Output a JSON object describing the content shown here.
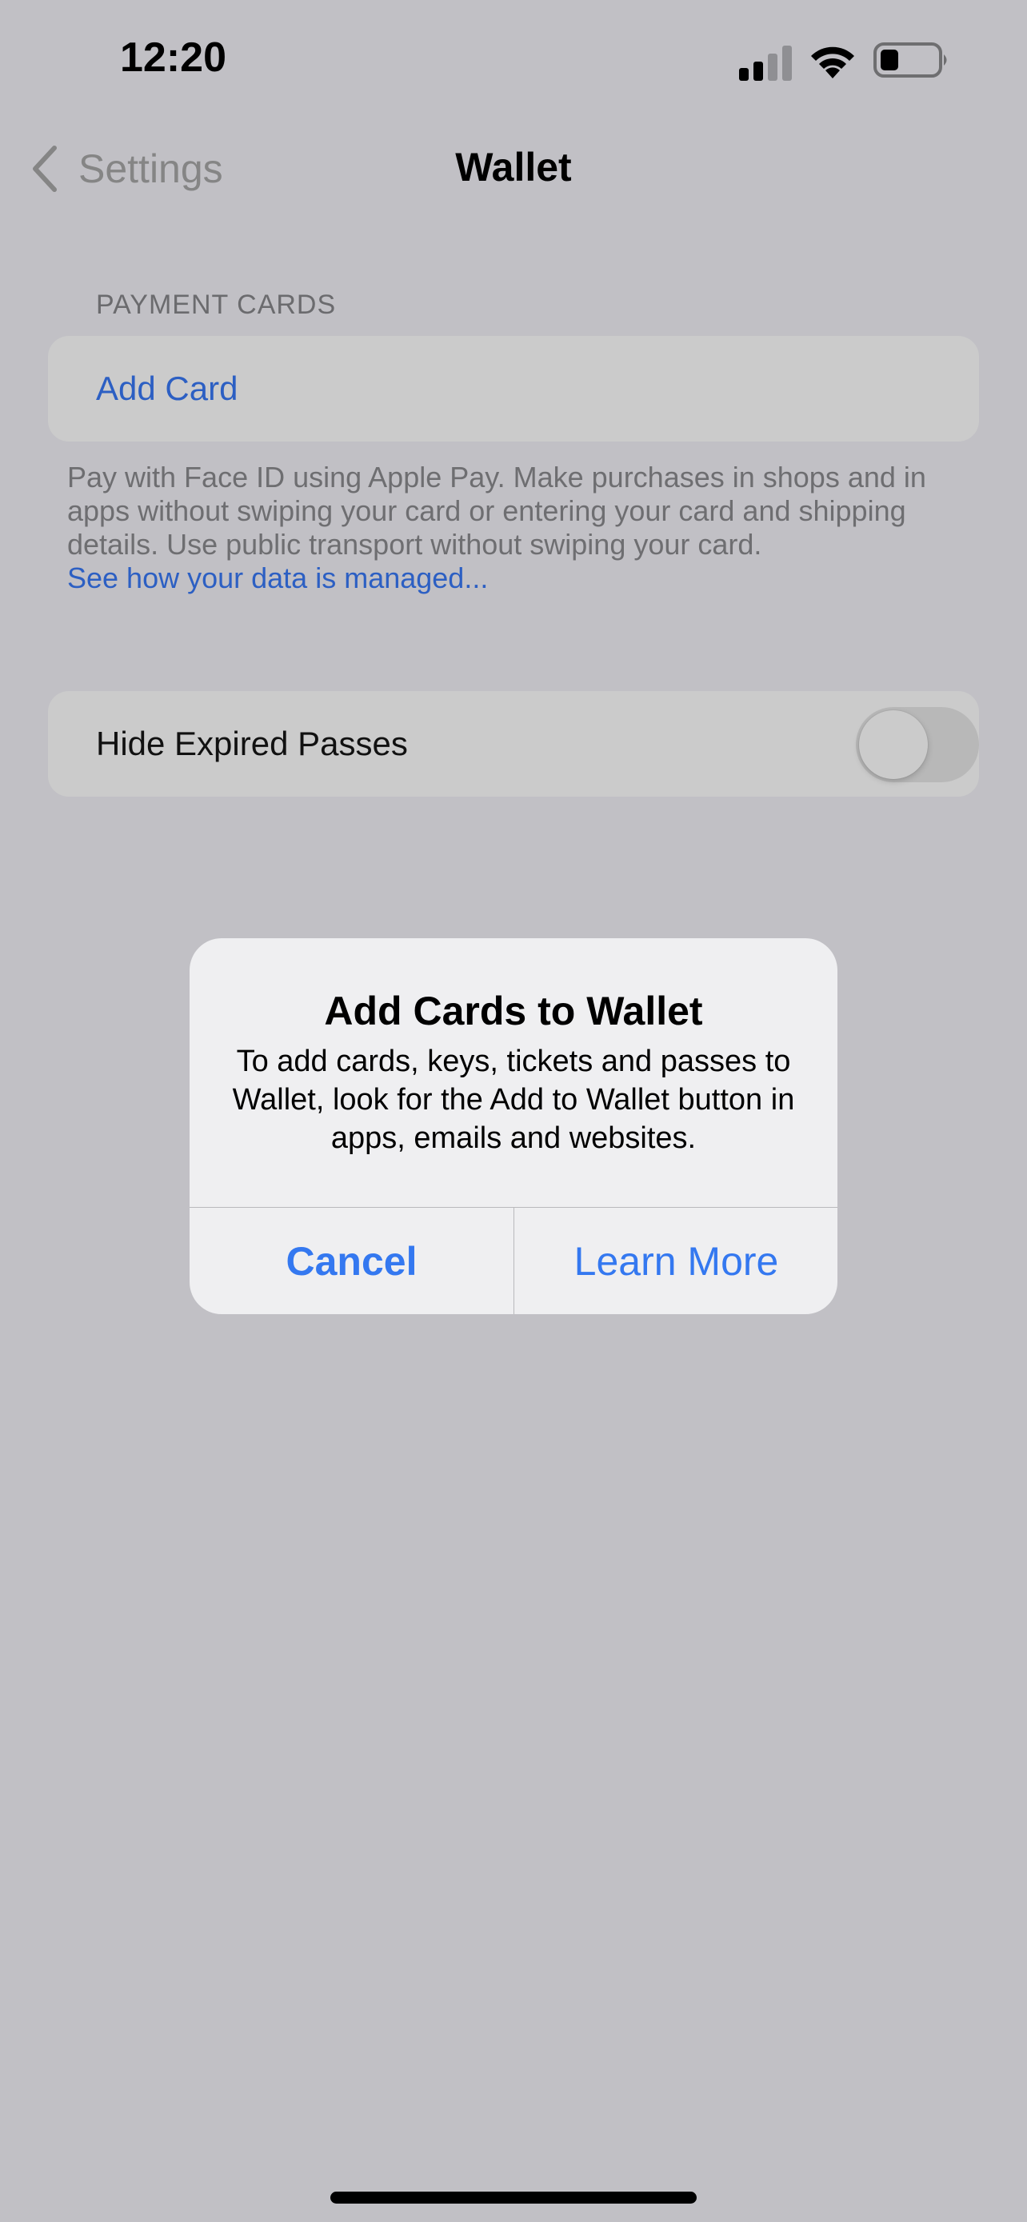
{
  "status_bar": {
    "time": "12:20",
    "signal_icon": "cellular-signal-icon",
    "signal_bars_active": 2,
    "signal_bars_total": 4,
    "wifi_icon": "wifi-icon",
    "battery_icon": "battery-icon",
    "battery_level_fraction": 0.25
  },
  "nav": {
    "back_label": "Settings",
    "back_icon": "chevron-left-icon",
    "title": "Wallet"
  },
  "payment_cards": {
    "header": "PAYMENT CARDS",
    "add_card_label": "Add Card",
    "footer_text": "Pay with Face ID using Apple Pay. Make purchases in shops and in apps without swiping your card or entering your card and shipping details. Use public transport without swiping your card.",
    "footer_link": "See how your data is managed..."
  },
  "passes": {
    "hide_expired_label": "Hide Expired Passes",
    "hide_expired_on": false
  },
  "alert": {
    "title": "Add Cards to Wallet",
    "message": "To add cards, keys, tickets and passes to Wallet, look for the Add to Wallet button in apps, emails and websites.",
    "cancel_label": "Cancel",
    "learn_more_label": "Learn More"
  },
  "colors": {
    "background": "#c1c0c5",
    "group_background": "#cbcbcb",
    "link_blue": "#2c5fc3",
    "alert_button_blue": "#3478f0",
    "alert_background": "#efeff1"
  }
}
